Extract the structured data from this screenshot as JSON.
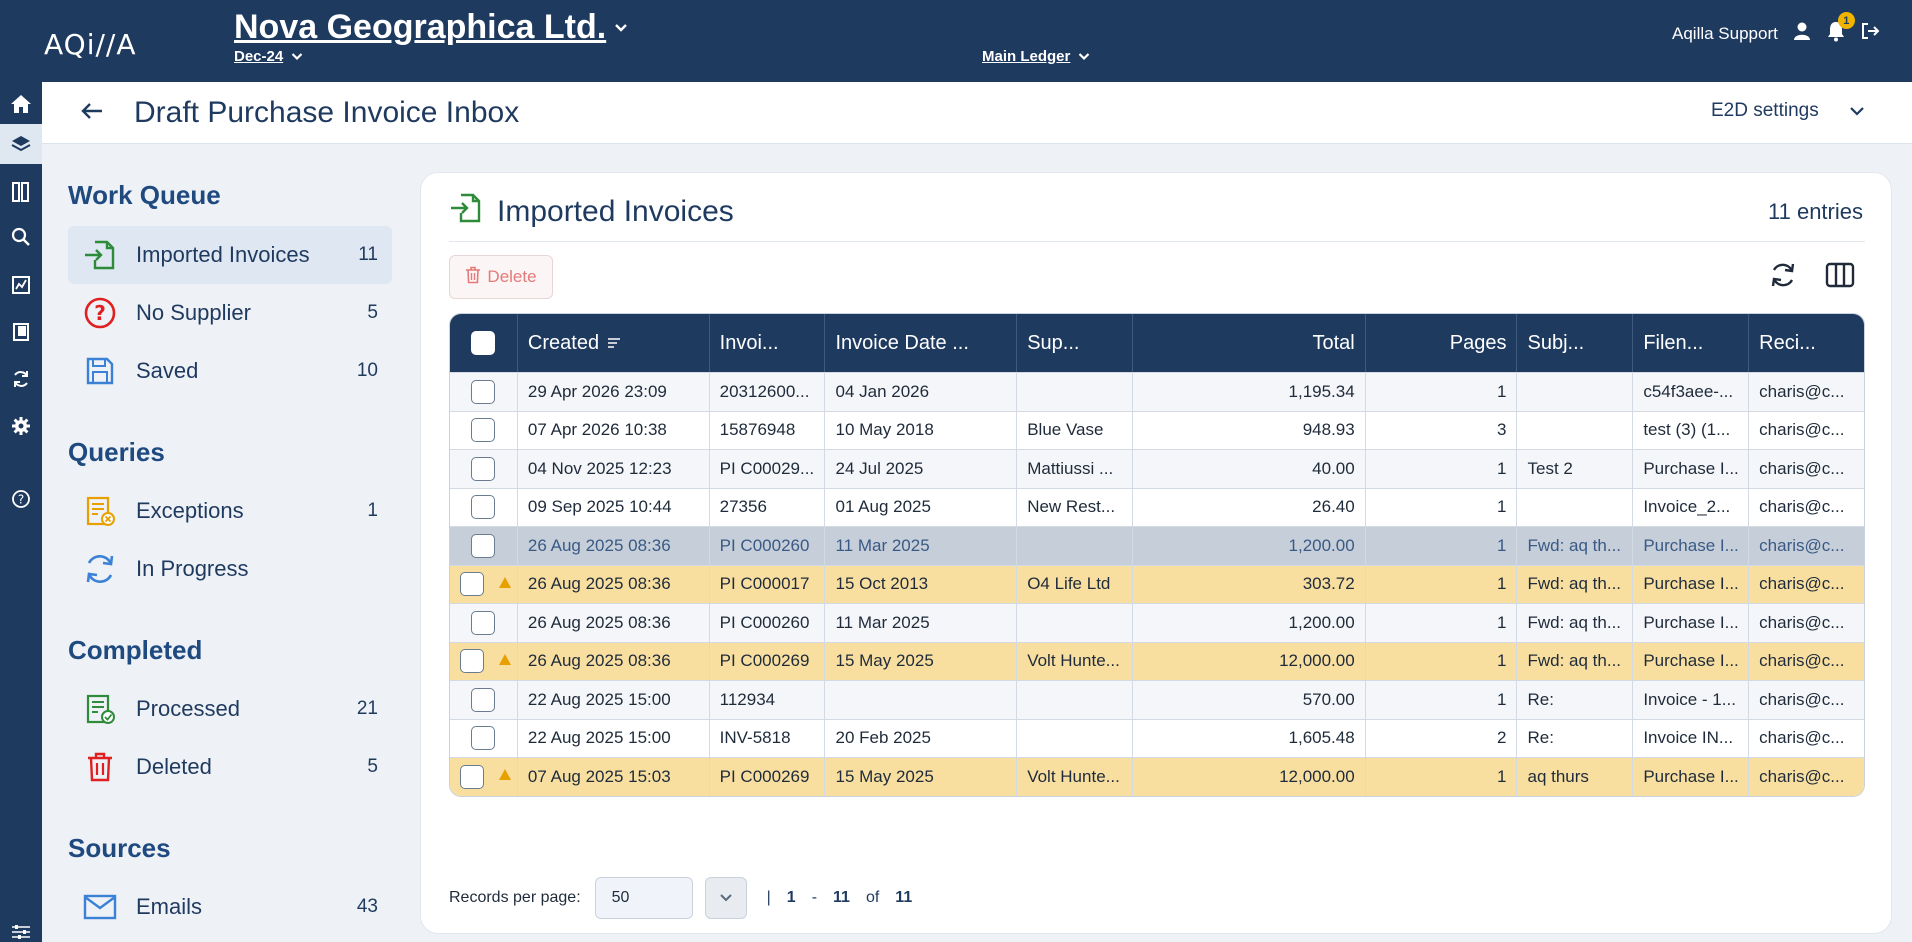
{
  "topbar": {
    "logo": "AQi//A",
    "company": "Nova Geographica Ltd.",
    "period": "Dec-24",
    "ledger": "Main Ledger",
    "user": "Aqilla Support",
    "notifications": "1"
  },
  "page": {
    "title": "Draft Purchase Invoice Inbox",
    "settings": "E2D settings"
  },
  "sidebar": {
    "work_queue_title": "Work Queue",
    "work_queue": [
      {
        "label": "Imported Invoices",
        "count": "11",
        "icon": "file-import-icon"
      },
      {
        "label": "No Supplier",
        "count": "5",
        "icon": "question-circle-icon"
      },
      {
        "label": "Saved",
        "count": "10",
        "icon": "save-icon"
      }
    ],
    "queries_title": "Queries",
    "queries": [
      {
        "label": "Exceptions",
        "count": "1",
        "icon": "exception-doc-icon"
      },
      {
        "label": "In Progress",
        "count": "",
        "icon": "sync-icon"
      }
    ],
    "completed_title": "Completed",
    "completed": [
      {
        "label": "Processed",
        "count": "21",
        "icon": "processed-doc-icon"
      },
      {
        "label": "Deleted",
        "count": "5",
        "icon": "trash-icon"
      }
    ],
    "sources_title": "Sources",
    "sources": [
      {
        "label": "Emails",
        "count": "43",
        "icon": "email-icon"
      }
    ]
  },
  "card": {
    "title": "Imported Invoices",
    "entries": "11 entries",
    "delete_label": "Delete"
  },
  "table": {
    "headers": [
      "Created",
      "Invoi...",
      "Invoice Date ...",
      "Sup...",
      "Total",
      "Pages",
      "Subj...",
      "Filen...",
      "Reci..."
    ],
    "rows": [
      [
        "29 Apr 2026 23:09",
        "20312600...",
        "04 Jan 2026",
        "",
        "1,195.34",
        "1",
        "",
        "c54f3aee-...",
        "charis@c..."
      ],
      [
        "07 Apr 2026 10:38",
        "15876948",
        "10 May 2018",
        "Blue Vase",
        "948.93",
        "3",
        "",
        "test (3) (1...",
        "charis@c..."
      ],
      [
        "04 Nov 2025 12:23",
        "PI C00029...",
        "24 Jul 2025",
        "Mattiussi ...",
        "40.00",
        "1",
        "Test 2",
        "Purchase I...",
        "charis@c..."
      ],
      [
        "09 Sep 2025 10:44",
        "27356",
        "01 Aug 2025",
        "New Rest...",
        "26.40",
        "1",
        "",
        "Invoice_2...",
        "charis@c..."
      ],
      [
        "26 Aug 2025 08:36",
        "PI C000260",
        "11 Mar 2025",
        "",
        "1,200.00",
        "1",
        "Fwd: aq th...",
        "Purchase I...",
        "charis@c..."
      ],
      [
        "26 Aug 2025 08:36",
        "PI C000017",
        "15 Oct 2013",
        "O4 Life Ltd",
        "303.72",
        "1",
        "Fwd: aq th...",
        "Purchase I...",
        "charis@c..."
      ],
      [
        "26 Aug 2025 08:36",
        "PI C000260",
        "11 Mar 2025",
        "",
        "1,200.00",
        "1",
        "Fwd: aq th...",
        "Purchase I...",
        "charis@c..."
      ],
      [
        "26 Aug 2025 08:36",
        "PI C000269",
        "15 May 2025",
        "Volt Hunte...",
        "12,000.00",
        "1",
        "Fwd: aq th...",
        "Purchase I...",
        "charis@c..."
      ],
      [
        "22 Aug 2025 15:00",
        "112934",
        "",
        "",
        "570.00",
        "1",
        "Re:",
        "Invoice - 1...",
        "charis@c..."
      ],
      [
        "22 Aug 2025 15:00",
        "INV-5818",
        "20 Feb 2025",
        "",
        "1,605.48",
        "2",
        "Re:",
        "Invoice IN...",
        "charis@c..."
      ],
      [
        "07 Aug 2025 15:03",
        "PI C000269",
        "15 May 2025",
        "Volt Hunte...",
        "12,000.00",
        "1",
        "aq thurs",
        "Purchase I...",
        "charis@c..."
      ]
    ],
    "row_states": [
      "",
      "",
      "",
      "",
      "sel",
      "warn",
      "",
      "warn",
      "",
      "",
      "warn"
    ]
  },
  "pager": {
    "label": "Records per page:",
    "value": "50",
    "sep": "|",
    "from": "1",
    "dash": "-",
    "to": "11",
    "of": "of",
    "total": "11"
  },
  "colors": {
    "navy": "#1f3a5f",
    "warn_row": "#f8dfa0",
    "selected_row": "#c5ced9",
    "accent_green": "#2e8b3a"
  }
}
